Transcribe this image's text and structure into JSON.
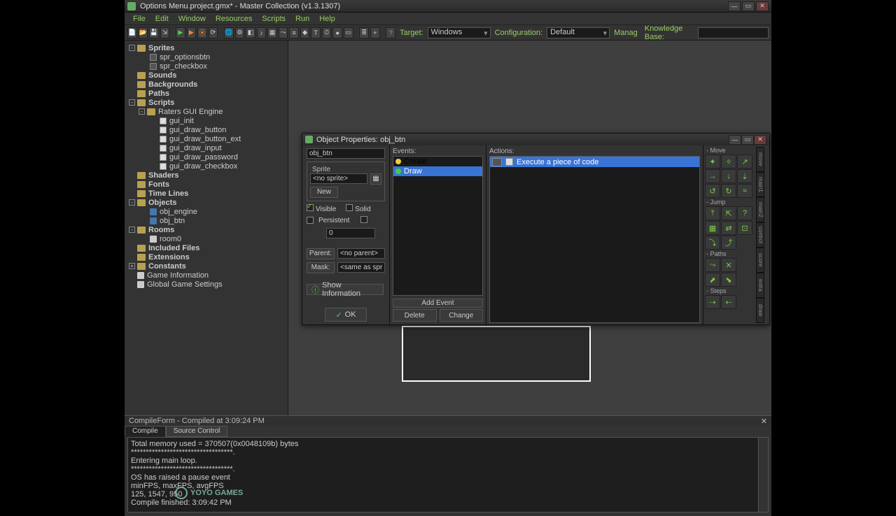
{
  "window": {
    "title": "Options Menu.project.gmx* - Master Collection (v1.3.1307)"
  },
  "menu": [
    "File",
    "Edit",
    "Window",
    "Resources",
    "Scripts",
    "Run",
    "Help"
  ],
  "toolbar": {
    "target_label": "Target:",
    "target_value": "Windows",
    "config_label": "Configuration:",
    "config_value": "Default",
    "manage_label": "Manag",
    "kb_label": "Knowledge Base:"
  },
  "tree": {
    "sprites": "Sprites",
    "spr_optionsbtn": "spr_optionsbtn",
    "spr_checkbox": "spr_checkbox",
    "sounds": "Sounds",
    "backgrounds": "Backgrounds",
    "paths": "Paths",
    "scripts": "Scripts",
    "raters": "Raters GUI Engine",
    "gui_init": "gui_init",
    "gui_draw_button": "gui_draw_button",
    "gui_draw_button_ext": "gui_draw_button_ext",
    "gui_draw_input": "gui_draw_input",
    "gui_draw_password": "gui_draw_password",
    "gui_draw_checkbox": "gui_draw_checkbox",
    "shaders": "Shaders",
    "fonts": "Fonts",
    "timelines": "Time Lines",
    "objects": "Objects",
    "obj_engine": "obj_engine",
    "obj_btn": "obj_btn",
    "rooms": "Rooms",
    "room0": "room0",
    "included": "Included Files",
    "extensions": "Extensions",
    "constants": "Constants",
    "gameinfo": "Game Information",
    "ggs": "Global Game Settings"
  },
  "dialog": {
    "title": "Object Properties: obj_btn",
    "name_value": "obj_btn",
    "sprite_legend": "Sprite",
    "sprite_value": "<no sprite>",
    "new_btn": "New",
    "visible": "Visible",
    "solid": "Solid",
    "persistent": "Persistent",
    "depth_value": "0",
    "parent_label": "Parent:",
    "parent_value": "<no parent>",
    "mask_label": "Mask:",
    "mask_value": "<same as sprite>",
    "show_info": "Show Information",
    "ok": "OK",
    "events_label": "Events:",
    "ev_create": "Create",
    "ev_draw": "Draw",
    "add_event": "Add Event",
    "delete": "Delete",
    "change": "Change",
    "actions_label": "Actions:",
    "act_exec": "Execute a piece of code",
    "pal_move": "- Move",
    "pal_jump": "- Jump",
    "pal_paths": "- Paths",
    "pal_steps": "- Steps",
    "tab_main1": "move",
    "tab_main2": "main1",
    "tab_main3": "main2",
    "tab_control": "control",
    "tab_score": "score",
    "tab_extra": "extra",
    "tab_draw": "draw"
  },
  "compile": {
    "header": "CompileForm - Compiled at 3:09:24 PM",
    "tab1": "Compile",
    "tab2": "Source Control",
    "l1": "Total memory used = 370507(0x0048109b) bytes",
    "l2": "**********************************.",
    "l3": "Entering main loop.",
    "l4": "**********************************.",
    "l5": "OS has raised a pause event",
    "l6": "",
    "l7": "minFPS, maxFPS, avgFPS",
    "l8": "125, 1547, 950",
    "l9": "",
    "l10": "Compile finished:  3:09:42 PM"
  },
  "logo": "YOYO GAMES"
}
